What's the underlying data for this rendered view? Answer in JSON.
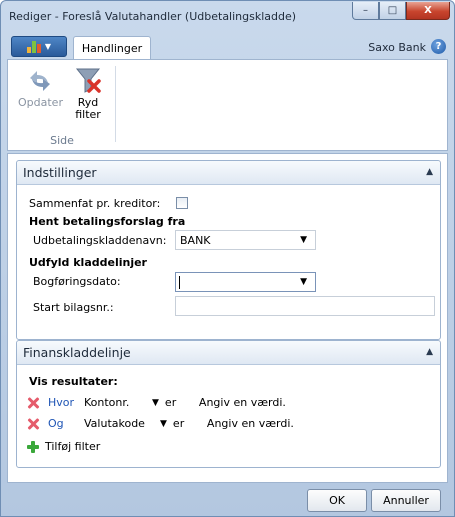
{
  "window": {
    "title": "Rediger - Foreslå Valutahandler (Udbetalingskladde)",
    "buttons": {
      "minimize": "–",
      "maximize": "□",
      "close": "X"
    }
  },
  "ribbon": {
    "tab": "Handlinger",
    "company": "Saxo Bank",
    "help": "?",
    "actions": [
      {
        "label": "Opdater",
        "icon": "refresh-icon",
        "enabled": false
      },
      {
        "label": "Ryd\nfilter",
        "icon": "clear-filter-icon",
        "enabled": true
      }
    ],
    "group_label": "Side"
  },
  "indstillinger": {
    "title": "Indstillinger",
    "collapse_icon": "▲",
    "sammenfat_label": "Sammenfat pr. kreditor:",
    "sammenfat_checked": false,
    "hent_heading": "Hent betalingsforslag fra",
    "kladdenavn_label": "Udbetalingskladdenavn:",
    "kladdenavn_value": "BANK",
    "udfyld_heading": "Udfyld kladdelinjer",
    "bogforingsdato_label": "Bogføringsdato:",
    "bogforingsdato_value": "",
    "startbilag_label": "Start bilagsnr.:",
    "startbilag_value": ""
  },
  "finanskladdelinje": {
    "title": "Finanskladdelinje",
    "collapse_icon": "▲",
    "vis_resultater": "Vis resultater:",
    "filters": [
      {
        "operator": "Hvor",
        "field": "Kontonr.",
        "comparison": "er",
        "value": "Angiv en værdi."
      },
      {
        "operator": "Og",
        "field": "Valutakode",
        "comparison": "er",
        "value": "Angiv en værdi."
      }
    ],
    "add_filter": "Tilføj filter"
  },
  "footer": {
    "ok": "OK",
    "cancel": "Annuller"
  },
  "colors": {
    "accent": "#1f55b5",
    "delete": "#e55b6b",
    "add": "#3aa83a",
    "title_bar": "#c9d9ec"
  }
}
